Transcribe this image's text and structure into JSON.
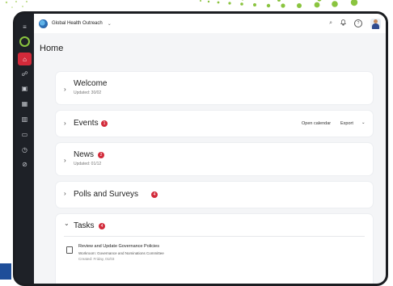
{
  "topbar": {
    "org_name": "Global Health Outreach",
    "org_chevron": "⌄",
    "search_icon": "⌕",
    "bell_icon": "🔔",
    "help_icon": "?"
  },
  "sidebar": {
    "items": [
      "menu-icon",
      "logo-icon",
      "home-icon",
      "network-icon",
      "briefcase-icon",
      "calendar-icon",
      "chart-icon",
      "inbox-icon",
      "clock-icon",
      "check-circle-icon"
    ],
    "active": "home-icon"
  },
  "page": {
    "title": "Home"
  },
  "welcome": {
    "title": "Welcome",
    "updated": "Updated: 30/02"
  },
  "events": {
    "title": "Events",
    "badge": "1",
    "open_calendar": "Open calendar",
    "export": "Export"
  },
  "news": {
    "title": "News",
    "badge": "2",
    "updated": "Updated: 01/12"
  },
  "polls": {
    "title": "Polls and Surveys",
    "badge": "4"
  },
  "tasks": {
    "title": "Tasks",
    "badge": "4",
    "items": [
      {
        "title": "Review and Update Governance Policies",
        "workroom": "Workroom: Governance and Nominations Committee",
        "created": "Created: Friday, 01/03"
      }
    ]
  },
  "colors": {
    "accent": "#d22a3a",
    "sidebar": "#1e2127",
    "logo_green": "#8ac43f"
  }
}
